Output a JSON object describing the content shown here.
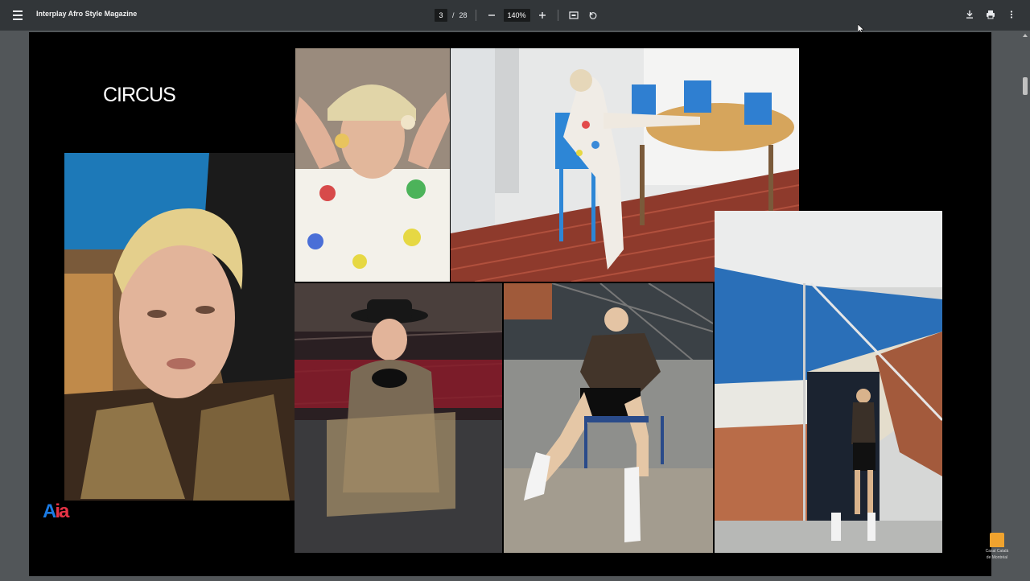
{
  "toolbar": {
    "title": "Interplay Afro Style Magazine",
    "page_current": "3",
    "page_separator": "/",
    "page_total": "28",
    "zoom": "140%"
  },
  "page": {
    "heading": "CIRCUS",
    "logo_a": "A",
    "logo_ia": "ia"
  },
  "watermark": {
    "line1": "Casal Català",
    "line2": "de Montréal"
  }
}
